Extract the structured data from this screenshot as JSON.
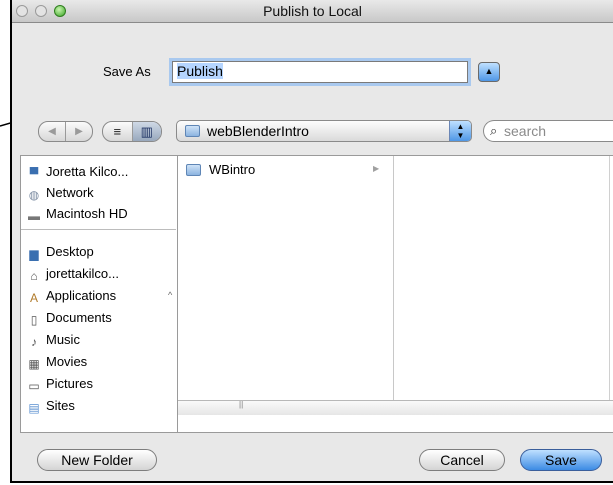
{
  "window": {
    "title": "Publish to Local"
  },
  "save_as": {
    "label": "Save As",
    "value": "Publish"
  },
  "toolbar": {
    "back_glyph": "◀",
    "forward_glyph": "▶",
    "list_view_glyph": "≡",
    "column_view_glyph": "▥",
    "path_popup_label": "webBlenderIntro",
    "search_placeholder": "search"
  },
  "sidebar": {
    "devices": [
      {
        "label": "Joretta Kilco...",
        "icon": "computer-icon"
      },
      {
        "label": "Network",
        "icon": "network-icon"
      },
      {
        "label": "Macintosh HD",
        "icon": "hard-drive-icon"
      }
    ],
    "places": [
      {
        "label": "Desktop",
        "icon": "desktop-icon"
      },
      {
        "label": "jorettakilco...",
        "icon": "home-icon"
      },
      {
        "label": "Applications",
        "icon": "applications-icon"
      },
      {
        "label": "Documents",
        "icon": "documents-icon"
      },
      {
        "label": "Music",
        "icon": "music-icon"
      },
      {
        "label": "Movies",
        "icon": "movies-icon"
      },
      {
        "label": "Pictures",
        "icon": "pictures-icon"
      },
      {
        "label": "Sites",
        "icon": "sites-icon"
      }
    ]
  },
  "browser": {
    "column1": [
      {
        "name": "WBintro",
        "icon": "folder-icon"
      }
    ]
  },
  "buttons": {
    "new_folder": "New Folder",
    "cancel": "Cancel",
    "save": "Save"
  },
  "colors": {
    "accent": "#3c8be4",
    "focus_ring": "#a9c9ef",
    "selection": "#b5d5ff"
  }
}
